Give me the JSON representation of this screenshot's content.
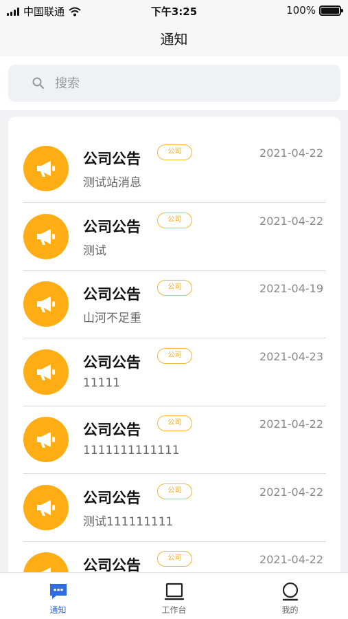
{
  "status_bar": {
    "carrier": "中国联通",
    "time": "下午3:25",
    "battery": "100%"
  },
  "nav": {
    "title": "通知"
  },
  "search": {
    "placeholder": "搜索"
  },
  "notifications": [
    {
      "title": "公司公告",
      "tag": "公司",
      "date": "2021-04-22",
      "body": "测试站消息"
    },
    {
      "title": "公司公告",
      "tag": "公司",
      "date": "2021-04-22",
      "body": "测试"
    },
    {
      "title": "公司公告",
      "tag": "公司",
      "date": "2021-04-19",
      "body": "山河不足重"
    },
    {
      "title": "公司公告",
      "tag": "公司",
      "date": "2021-04-23",
      "body": "11111"
    },
    {
      "title": "公司公告",
      "tag": "公司",
      "date": "2021-04-22",
      "body": "1111111111111"
    },
    {
      "title": "公司公告",
      "tag": "公司",
      "date": "2021-04-22",
      "body": "测试111111111"
    },
    {
      "title": "公司公告",
      "tag": "公司",
      "date": "2021-04-22",
      "body": ""
    }
  ],
  "tabs": [
    {
      "label": "通知",
      "icon": "chat-bubble-icon",
      "active": true
    },
    {
      "label": "工作台",
      "icon": "laptop-icon",
      "active": false
    },
    {
      "label": "我的",
      "icon": "user-icon",
      "active": false
    }
  ],
  "colors": {
    "accent": "#2f6de0",
    "avatar": "#ffad14",
    "tag": "#f5b82e"
  }
}
